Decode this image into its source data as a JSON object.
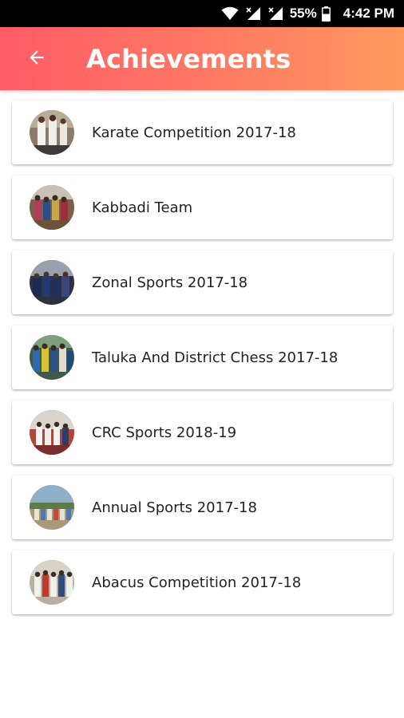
{
  "status_bar": {
    "battery": "55%",
    "time": "4:42 PM",
    "icons": [
      "wifi-icon",
      "signal-icon",
      "signal-icon",
      "battery-icon"
    ]
  },
  "app_bar": {
    "title": "Achievements",
    "back_icon": "arrow-left-icon",
    "gradient": [
      "#ff5c67",
      "#ff9a5e"
    ]
  },
  "achievements": [
    {
      "label": "Karate Competition 2017-18"
    },
    {
      "label": "Kabbadi Team"
    },
    {
      "label": "Zonal Sports 2017-18"
    },
    {
      "label": "Taluka And District Chess 2017-18"
    },
    {
      "label": "CRC Sports 2018-19"
    },
    {
      "label": "Annual Sports 2017-18"
    },
    {
      "label": "Abacus Competition 2017-18"
    }
  ]
}
